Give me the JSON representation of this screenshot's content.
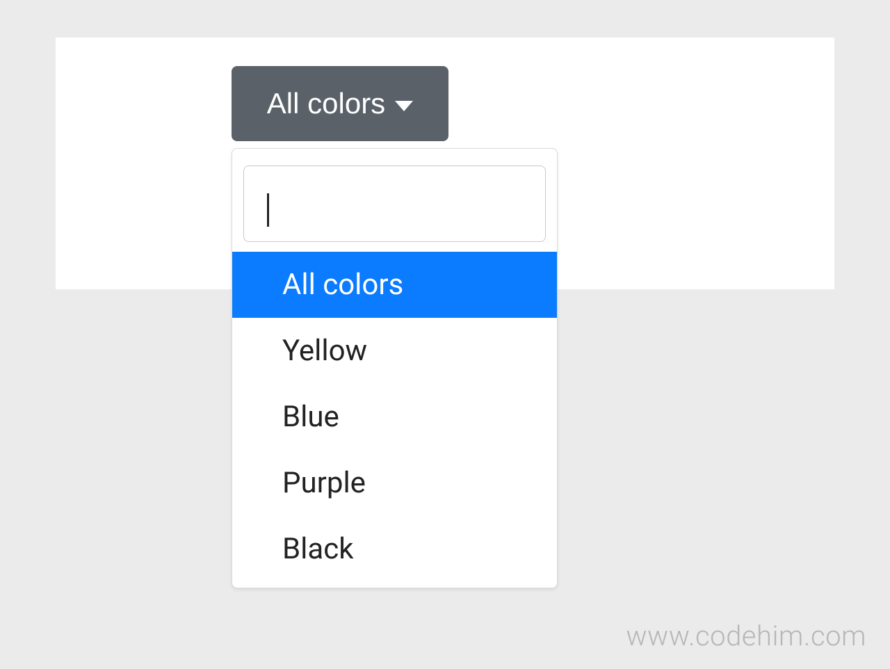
{
  "dropdown": {
    "toggle_label": "All colors",
    "search_value": "",
    "options": [
      {
        "label": "All colors",
        "active": true
      },
      {
        "label": "Yellow",
        "active": false
      },
      {
        "label": "Blue",
        "active": false
      },
      {
        "label": "Purple",
        "active": false
      },
      {
        "label": "Black",
        "active": false
      }
    ]
  },
  "watermark": "www.codehim.com",
  "colors": {
    "toggle_bg": "#5a6168",
    "active_bg": "#0b7bff",
    "page_bg": "#ebebeb",
    "card_bg": "#ffffff"
  }
}
